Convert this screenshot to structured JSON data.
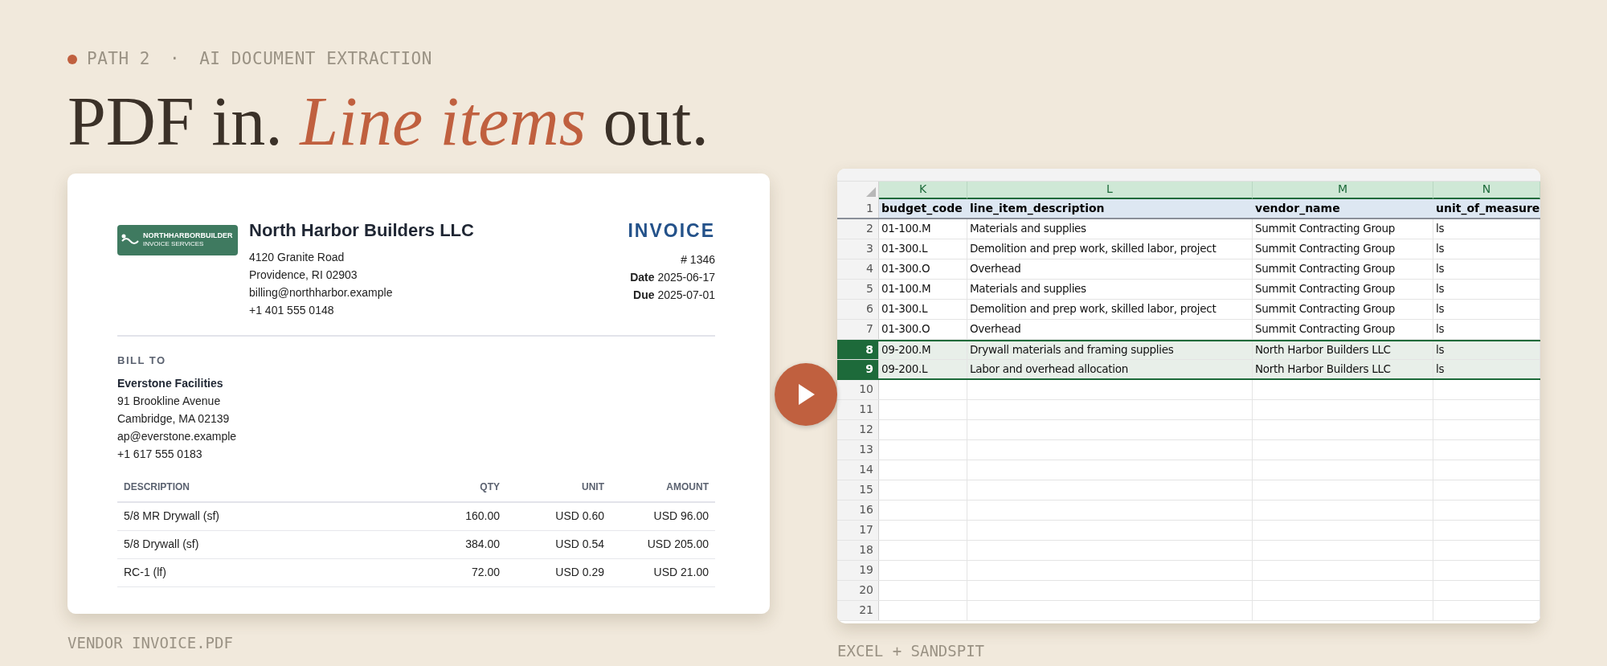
{
  "eyebrow": {
    "path": "PATH 2",
    "separator": "·",
    "topic": "AI DOCUMENT EXTRACTION"
  },
  "headline": "PDF in. *Line items* out.",
  "invoice": {
    "logo": {
      "name": "NORTHHARBORBUILDER",
      "tagline": "INVOICE SERVICES"
    },
    "company": "North Harbor Builders LLC",
    "address": [
      "4120 Granite Road",
      "Providence, RI 02903",
      "billing@northharbor.example",
      "+1 401 555 0148"
    ],
    "title": "INVOICE",
    "number": "# 1346",
    "meta": [
      {
        "label": "Date",
        "value": "2025-06-17"
      },
      {
        "label": "Due",
        "value": "2025-07-01"
      }
    ],
    "bill_to": {
      "label": "BILL TO",
      "name": "Everstone Facilities",
      "lines": [
        "91 Brookline Avenue",
        "Cambridge, MA 02139",
        "ap@everstone.example",
        "+1 617 555 0183"
      ]
    },
    "table": {
      "columns": [
        "DESCRIPTION",
        "QTY",
        "UNIT",
        "AMOUNT"
      ],
      "rows": [
        [
          "5/8 MR Drywall (sf)",
          "160.00",
          "USD 0.60",
          "USD 96.00"
        ],
        [
          "5/8 Drywall (sf)",
          "384.00",
          "USD 0.54",
          "USD 205.00"
        ],
        [
          "RC-1 (lf)",
          "72.00",
          "USD 0.29",
          "USD 21.00"
        ]
      ]
    }
  },
  "invoice_caption": "VENDOR INVOICE.PDF",
  "spreadsheet": {
    "columns": [
      "K",
      "L",
      "M",
      "N"
    ],
    "header_row": {
      "number": "1",
      "cells": [
        "budget_code",
        "line_item_description",
        "vendor_name",
        "unit_of_measure"
      ]
    },
    "rows": [
      {
        "number": "2",
        "selected": false,
        "cells": [
          "01-100.M",
          "Materials and supplies",
          "Summit Contracting Group",
          "ls"
        ]
      },
      {
        "number": "3",
        "selected": false,
        "cells": [
          "01-300.L",
          "Demolition and prep work, skilled labor, project",
          "Summit Contracting Group",
          "ls"
        ]
      },
      {
        "number": "4",
        "selected": false,
        "cells": [
          "01-300.O",
          "Overhead",
          "Summit Contracting Group",
          "ls"
        ]
      },
      {
        "number": "5",
        "selected": false,
        "cells": [
          "01-100.M",
          "Materials and supplies",
          "Summit Contracting Group",
          "ls"
        ]
      },
      {
        "number": "6",
        "selected": false,
        "cells": [
          "01-300.L",
          "Demolition and prep work, skilled labor, project",
          "Summit Contracting Group",
          "ls"
        ]
      },
      {
        "number": "7",
        "selected": false,
        "cells": [
          "01-300.O",
          "Overhead",
          "Summit Contracting Group",
          "ls"
        ]
      },
      {
        "number": "8",
        "selected": true,
        "cells": [
          "09-200.M",
          "Drywall materials and framing supplies",
          "North Harbor Builders LLC",
          "ls"
        ]
      },
      {
        "number": "9",
        "selected": true,
        "cells": [
          "09-200.L",
          "Labor and overhead allocation",
          "North Harbor Builders LLC",
          "ls"
        ]
      },
      {
        "number": "10",
        "selected": false,
        "cells": []
      },
      {
        "number": "11",
        "selected": false,
        "cells": []
      },
      {
        "number": "12",
        "selected": false,
        "cells": []
      },
      {
        "number": "13",
        "selected": false,
        "cells": []
      },
      {
        "number": "14",
        "selected": false,
        "cells": []
      },
      {
        "number": "15",
        "selected": false,
        "cells": []
      },
      {
        "number": "16",
        "selected": false,
        "cells": []
      },
      {
        "number": "17",
        "selected": false,
        "cells": []
      },
      {
        "number": "18",
        "selected": false,
        "cells": []
      },
      {
        "number": "19",
        "selected": false,
        "cells": []
      },
      {
        "number": "20",
        "selected": false,
        "cells": []
      },
      {
        "number": "21",
        "selected": false,
        "cells": []
      }
    ]
  },
  "spreadsheet_caption": "EXCEL + SANDSPIT"
}
